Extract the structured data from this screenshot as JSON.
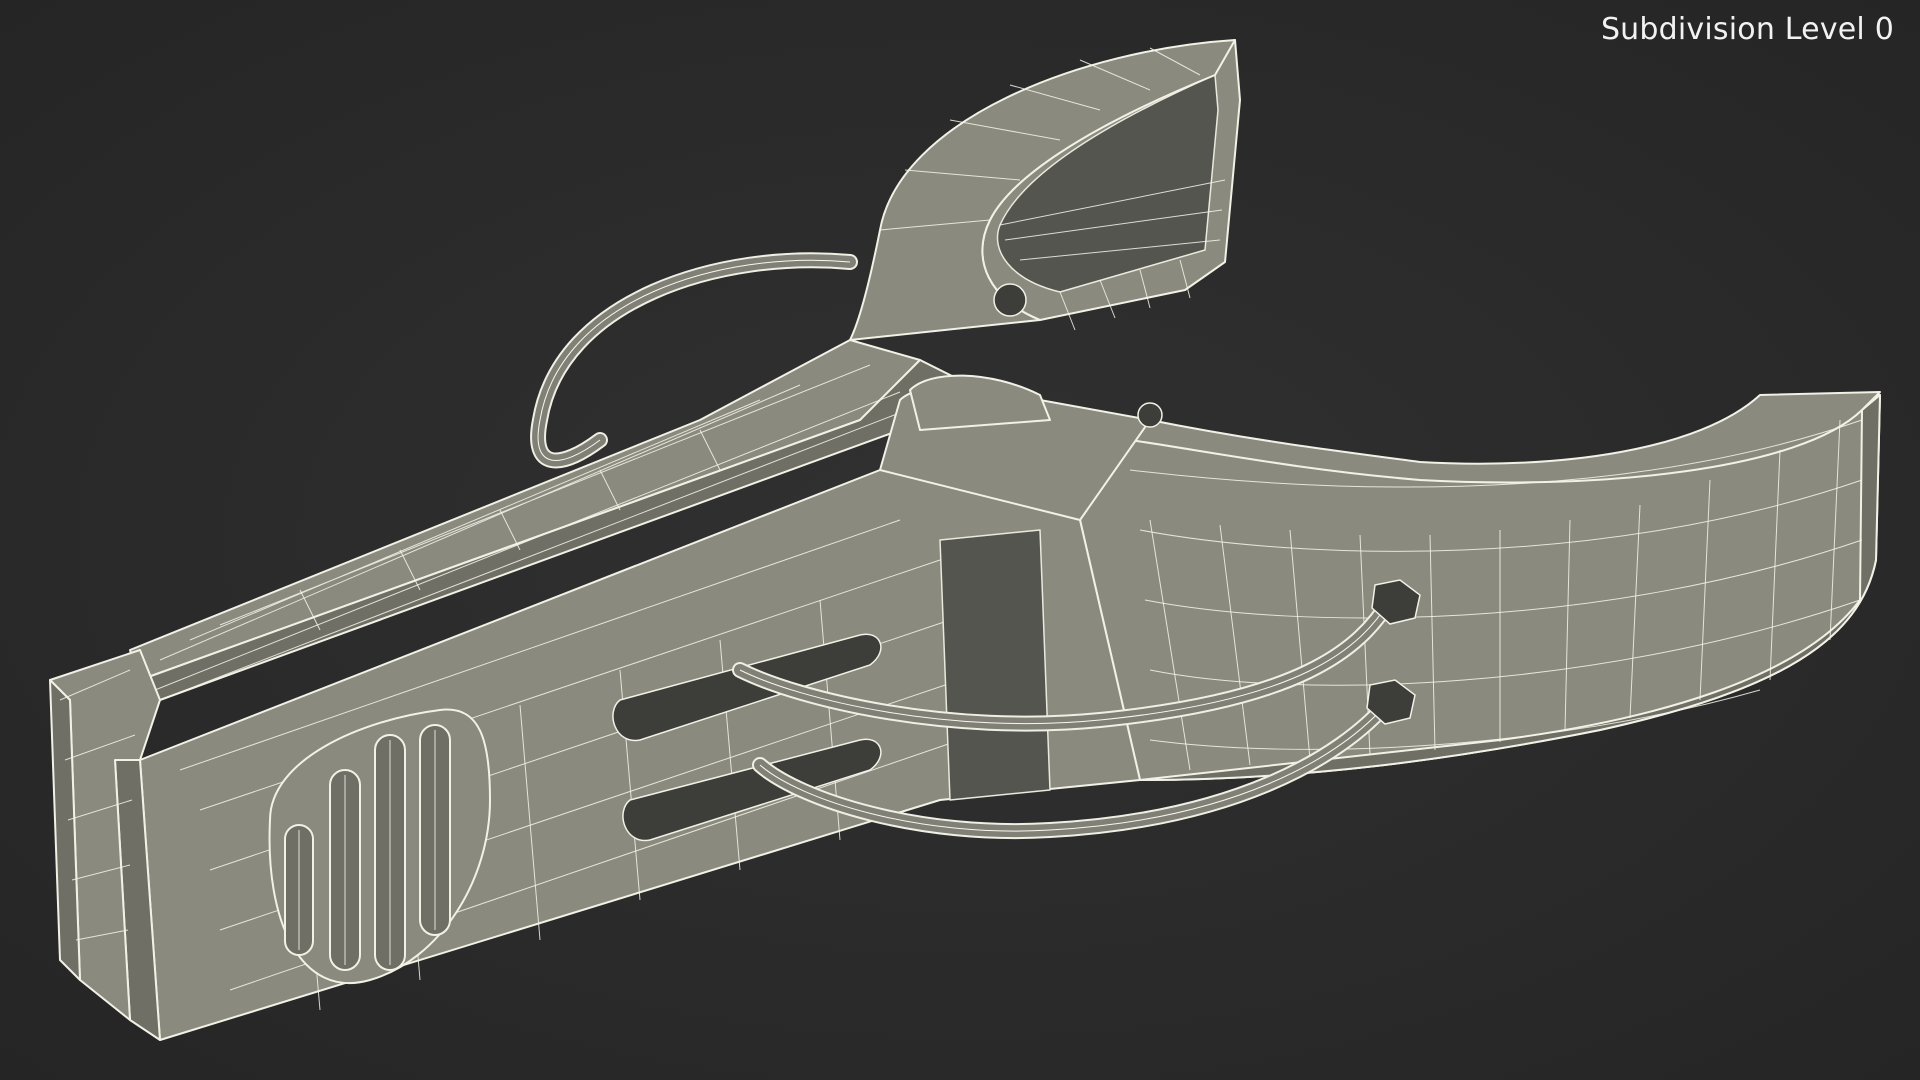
{
  "viewport": {
    "overlay_label": "Subdivision Level 0",
    "background_color": "#2b2b2b",
    "mesh_fill_color": "#8a8a7e",
    "wireframe_color": "#f1f1e6"
  },
  "model": {
    "icon": "clothespin-wireframe-icon"
  }
}
